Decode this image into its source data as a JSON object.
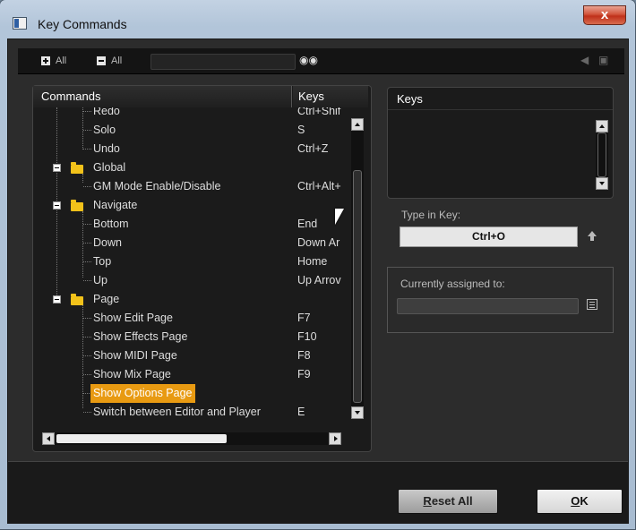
{
  "window": {
    "title": "Key Commands",
    "close_glyph": "x"
  },
  "toolbar": {
    "expand_all": "All",
    "collapse_all": "All"
  },
  "commands_panel": {
    "col_commands": "Commands",
    "col_keys": "Keys",
    "rows": [
      {
        "label": "Redo",
        "key": "Ctrl+Shif",
        "kind": "leaf",
        "selected": false
      },
      {
        "label": "Solo",
        "key": "S",
        "kind": "leaf",
        "selected": false
      },
      {
        "label": "Undo",
        "key": "Ctrl+Z",
        "kind": "leaf",
        "selected": false
      },
      {
        "label": "Global",
        "key": "",
        "kind": "folder",
        "selected": false
      },
      {
        "label": "GM Mode Enable/Disable",
        "key": "Ctrl+Alt+",
        "kind": "leaf",
        "selected": false
      },
      {
        "label": "Navigate",
        "key": "",
        "kind": "folder",
        "selected": false
      },
      {
        "label": "Bottom",
        "key": "End",
        "kind": "leaf",
        "selected": false
      },
      {
        "label": "Down",
        "key": "Down Ar",
        "kind": "leaf",
        "selected": false
      },
      {
        "label": "Top",
        "key": "Home",
        "kind": "leaf",
        "selected": false
      },
      {
        "label": "Up",
        "key": "Up Arrov",
        "kind": "leaf",
        "selected": false
      },
      {
        "label": "Page",
        "key": "",
        "kind": "folder",
        "selected": false
      },
      {
        "label": "Show Edit Page",
        "key": "F7",
        "kind": "leaf",
        "selected": false
      },
      {
        "label": "Show Effects Page",
        "key": "F10",
        "kind": "leaf",
        "selected": false
      },
      {
        "label": "Show MIDI Page",
        "key": "F8",
        "kind": "leaf",
        "selected": false
      },
      {
        "label": "Show Mix Page",
        "key": "F9",
        "kind": "leaf",
        "selected": false
      },
      {
        "label": "Show Options Page",
        "key": "",
        "kind": "leaf",
        "selected": true
      },
      {
        "label": "Switch between Editor and Player",
        "key": "E",
        "kind": "leaf",
        "selected": false
      }
    ]
  },
  "keys_panel": {
    "header": "Keys"
  },
  "type_in": {
    "label": "Type in Key:",
    "value": "Ctrl+O"
  },
  "assigned": {
    "label": "Currently assigned to:"
  },
  "buttons": {
    "reset_prefix": "R",
    "reset_rest": "eset All",
    "ok_prefix": "O",
    "ok_rest": "K"
  },
  "colors": {
    "selection": "#e89a12",
    "folder": "#f2c21a",
    "panel_bg": "#1b1b1b"
  }
}
